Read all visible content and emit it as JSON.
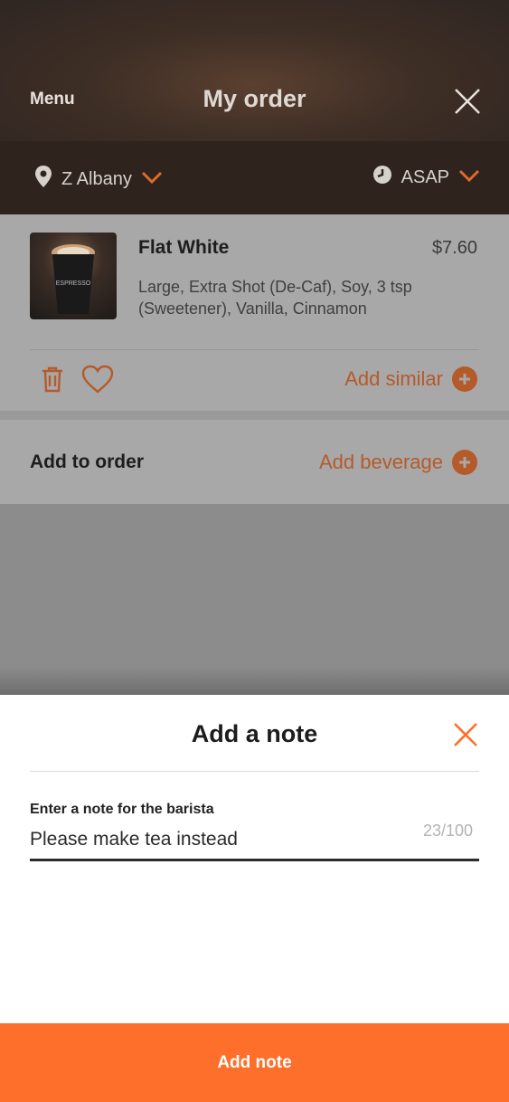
{
  "header": {
    "menu_label": "Menu",
    "title": "My order",
    "close_icon": "close-icon"
  },
  "location_bar": {
    "store": "Z Albany",
    "pickup_time": "ASAP",
    "accent_color": "#e06a2a"
  },
  "order": {
    "items": [
      {
        "name": "Flat White",
        "price": "$7.60",
        "options": "Large, Extra Shot (De-Caf), Soy, 3 tsp (Sweetener), Vanilla, Cinnamon",
        "thumb_logo": "ESPRESSO",
        "add_similar_label": "Add similar"
      }
    ]
  },
  "add_to_order": {
    "label": "Add to order",
    "add_beverage_label": "Add beverage"
  },
  "note_sheet": {
    "title": "Add a note",
    "field_label": "Enter a note for the barista",
    "field_value": "Please make tea instead",
    "counter": "23/100",
    "submit_label": "Add note",
    "accent_color": "#fe6f2b"
  }
}
